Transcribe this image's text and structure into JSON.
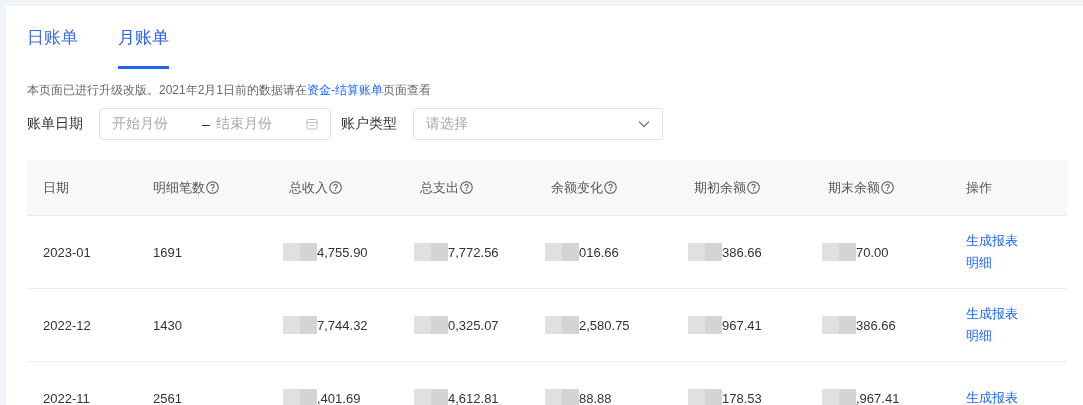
{
  "tabs": [
    {
      "label": "日账单",
      "selected": false
    },
    {
      "label": "月账单",
      "selected": true
    }
  ],
  "notice": {
    "text": "本页面已进行升级改版。2021年2月1日前的数据请在",
    "link": "资金-结算账单",
    "suffix": "页面查看"
  },
  "filters": {
    "date_label": "账单日期",
    "start_placeholder": "开始月份",
    "separator": "–",
    "end_placeholder": "结束月份",
    "type_label": "账户类型",
    "type_placeholder": "请选择"
  },
  "table": {
    "columns": [
      {
        "label": "日期",
        "help": false
      },
      {
        "label": "明细笔数",
        "help": true
      },
      {
        "label": "总收入",
        "help": true
      },
      {
        "label": "总支出",
        "help": true
      },
      {
        "label": "余额变化",
        "help": true
      },
      {
        "label": "期初余额",
        "help": true
      },
      {
        "label": "期末余额",
        "help": true
      },
      {
        "label": "操作",
        "help": false
      }
    ],
    "rows": [
      {
        "date": "2023-01",
        "count": "1691",
        "amounts": [
          "4,755.90",
          "7,772.56",
          "016.66",
          "386.66",
          "70.00"
        ],
        "actions": [
          "生成报表",
          "明细"
        ]
      },
      {
        "date": "2022-12",
        "count": "1430",
        "amounts": [
          "7,744.32",
          "0,325.07",
          "2,580.75",
          "967.41",
          "386.66"
        ],
        "actions": [
          "生成报表",
          "明细"
        ]
      },
      {
        "date": "2022-11",
        "count": "2561",
        "amounts": [
          ",401.69",
          "4,612.81",
          "88.88",
          "178.53",
          ",967.41"
        ],
        "actions": [
          "生成报表"
        ]
      }
    ]
  }
}
